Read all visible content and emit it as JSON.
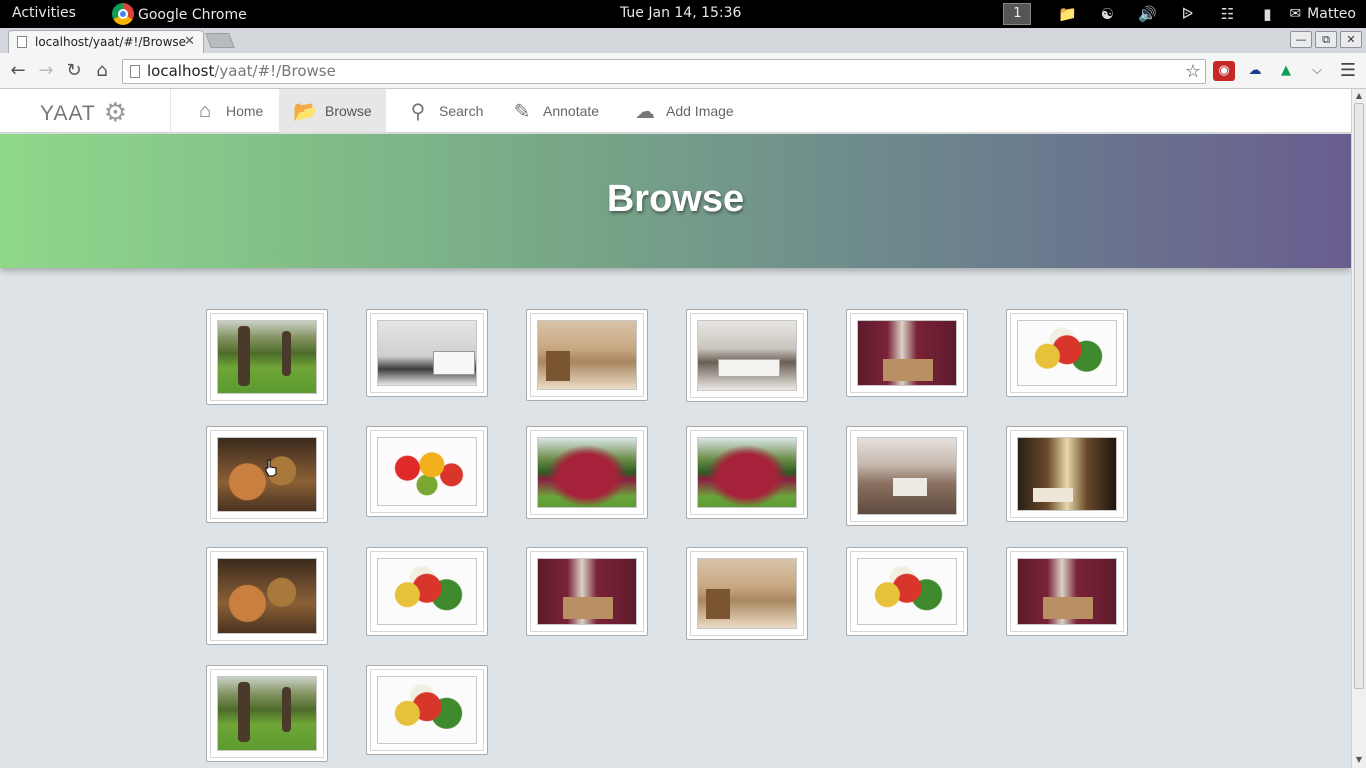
{
  "os_bar": {
    "activities": "Activities",
    "app_name": "Google Chrome",
    "clock": "Tue Jan 14, 15:36",
    "workspace": "1",
    "user": "Matteo"
  },
  "browser": {
    "tab_title": "localhost/yaat/#!/Browse",
    "url_host": "localhost",
    "url_path": "/yaat/#!/Browse"
  },
  "app": {
    "brand": "YAAT",
    "nav": [
      {
        "label": "Home",
        "icon": "home-icon",
        "active": false
      },
      {
        "label": "Browse",
        "icon": "folder-open-icon",
        "active": true
      },
      {
        "label": "Search",
        "icon": "search-icon",
        "active": false
      },
      {
        "label": "Annotate",
        "icon": "pencil-icon",
        "active": false
      },
      {
        "label": "Add Image",
        "icon": "cloud-upload-icon",
        "active": false
      }
    ],
    "page_title": "Browse"
  },
  "gallery": {
    "images": [
      {
        "subject": "garden"
      },
      {
        "subject": "bathroom-white"
      },
      {
        "subject": "bathroom-beige"
      },
      {
        "subject": "bedroom-white"
      },
      {
        "subject": "bedroom-maroon"
      },
      {
        "subject": "vegetables"
      },
      {
        "subject": "deli"
      },
      {
        "subject": "fruit"
      },
      {
        "subject": "flowers"
      },
      {
        "subject": "flowers"
      },
      {
        "subject": "bedroom-classic"
      },
      {
        "subject": "bathroom-dark"
      },
      {
        "subject": "deli"
      },
      {
        "subject": "vegetables"
      },
      {
        "subject": "bedroom-maroon"
      },
      {
        "subject": "bathroom-beige"
      },
      {
        "subject": "vegetables"
      },
      {
        "subject": "bedroom-maroon"
      },
      {
        "subject": "garden"
      },
      {
        "subject": "vegetables"
      }
    ]
  },
  "colors": {
    "hero_start": "#8fd98a",
    "hero_end": "#695d8f",
    "page_bg": "#dde3e6"
  }
}
